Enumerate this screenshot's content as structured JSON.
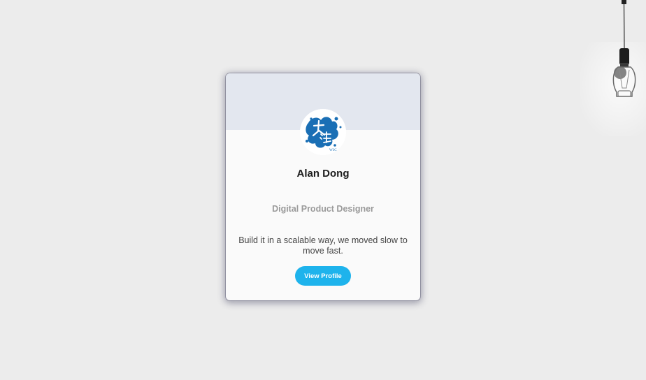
{
  "profile": {
    "name": "Alan Dong",
    "title": "Digital Product Designer",
    "bio": "Build it in a scalable way, we moved slow to move fast.",
    "button_label": "View Profile",
    "avatar_icon": "ink-splash-logo-icon",
    "avatar_text": "大 湛 W3C"
  },
  "decor": {
    "lamp_icon": "hanging-lightbulb-icon"
  },
  "colors": {
    "page_background": "#ececec",
    "card_background": "#fafafa",
    "card_header": "#e3e7ef",
    "button": "#1eb3ec",
    "name_text": "#1c1c1c",
    "title_text": "#9a9a9a",
    "bio_text": "#444444",
    "avatar_ink": "#1a6fb5"
  }
}
